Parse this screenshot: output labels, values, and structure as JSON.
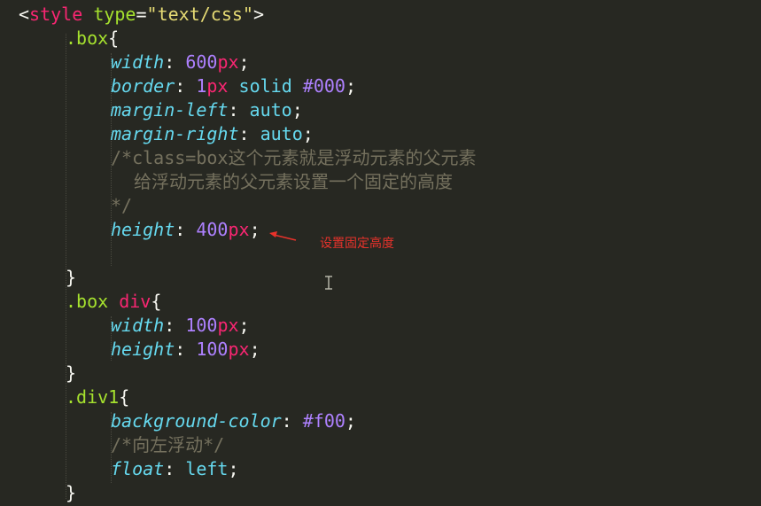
{
  "code": {
    "l1": {
      "open": "<",
      "tag": "style",
      "attr": "type",
      "eq": "=",
      "value": "\"text/css\"",
      "close": ">"
    },
    "l2": {
      "selector": ".box",
      "brace": "{"
    },
    "l3": {
      "prop": "width",
      "colon": ": ",
      "num": "600",
      "unit": "px",
      "end": ";"
    },
    "l4": {
      "prop": "border",
      "colon": ": ",
      "num": "1",
      "unit": "px",
      "rest": " solid ",
      "color": "#000",
      "end": ";"
    },
    "l5": {
      "prop": "margin-left",
      "colon": ": ",
      "value": "auto",
      "end": ";"
    },
    "l6": {
      "prop": "margin-right",
      "colon": ": ",
      "value": "auto",
      "end": ";"
    },
    "l7": {
      "text": "/*class=box这个元素就是浮动元素的父元素"
    },
    "l8": {
      "text": "给浮动元素的父元素设置一个固定的高度"
    },
    "l9": {
      "text": "*/"
    },
    "l10": {
      "prop": "height",
      "colon": ": ",
      "num": "400",
      "unit": "px",
      "end": ";"
    },
    "l12": {
      "brace": "}"
    },
    "l13": {
      "selector": ".box",
      "tag": "div",
      "brace": "{"
    },
    "l14": {
      "prop": "width",
      "colon": ": ",
      "num": "100",
      "unit": "px",
      "end": ";"
    },
    "l15": {
      "prop": "height",
      "colon": ": ",
      "num": "100",
      "unit": "px",
      "end": ";"
    },
    "l16": {
      "brace": "}"
    },
    "l17": {
      "selector": ".div1",
      "brace": "{"
    },
    "l18": {
      "prop": "background-color",
      "colon": ": ",
      "color": "#f00",
      "end": ";"
    },
    "l19": {
      "text": "/*向左浮动*/"
    },
    "l20": {
      "prop": "float",
      "colon": ": ",
      "value": "left",
      "end": ";"
    },
    "l21": {
      "brace": "}"
    }
  },
  "annotation": {
    "text": "设置固定高度",
    "color": "#e8322b"
  },
  "theme": {
    "background": "#272822",
    "tag": "#f92672",
    "selector": "#a6e22e",
    "property": "#66d9ef",
    "number": "#ae81ff",
    "comment": "#75715e",
    "string": "#e6db74"
  },
  "icons": {
    "arrow": "red-arrow-icon",
    "cursor": "text-cursor-icon"
  }
}
